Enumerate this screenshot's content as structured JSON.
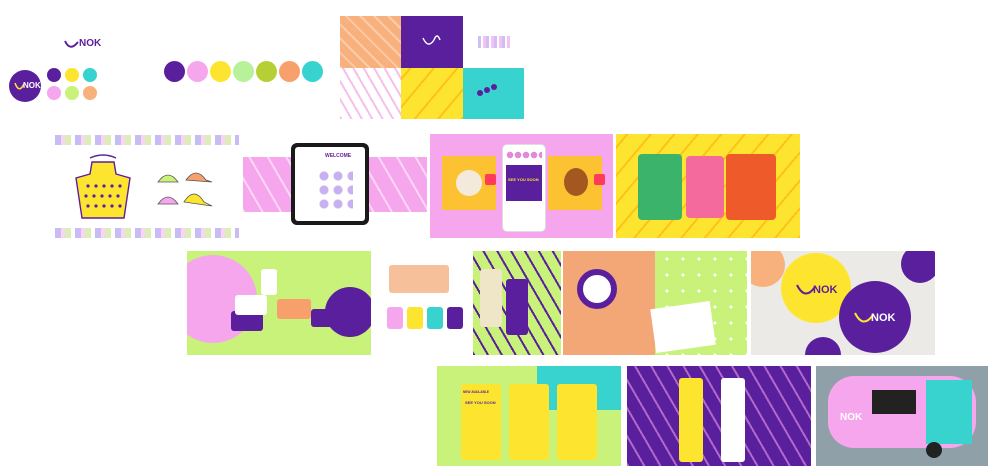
{
  "brand": {
    "name": "NOK",
    "logo_text": "NOK"
  },
  "palette": {
    "main": [
      "#5a1f9c",
      "#f6a6ec",
      "#fde52f",
      "#b7f29a",
      "#b6cf35",
      "#f8a06c",
      "#38d3cf"
    ],
    "mini": [
      "#5a1f9c",
      "#fde52f",
      "#38d3cf",
      "#f6a6ec",
      "#c9f27a",
      "#f8b07c"
    ]
  },
  "mockups": {
    "promo_headline": "NEW AVAILABLE",
    "promo_sub": "SEE YOU SOON",
    "tablet_headline": "WELCOME",
    "phone_headline": "SEE YOU SOON",
    "truck_label": "NOK"
  }
}
